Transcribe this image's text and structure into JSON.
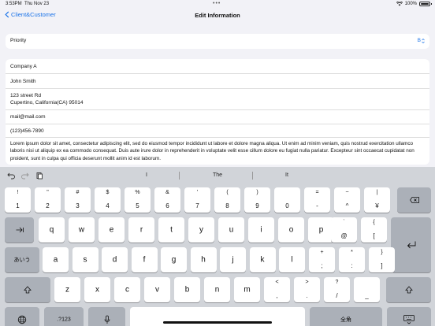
{
  "status_bar": {
    "time": "3:53PM",
    "date": "Thu Nov 23",
    "dots": "•••",
    "battery": "100%"
  },
  "nav": {
    "back_label": "Client&Customer",
    "title": "Edit Information"
  },
  "priority": {
    "label": "Priority",
    "value": "B"
  },
  "info": {
    "company": "Company A",
    "name": "John Smith",
    "address_line1": "123 street Rd",
    "address_line2": "Cupertino, California(CA) 95014",
    "email": "mail@mail.com",
    "phone": "(123)456-7890",
    "notes": "Lorem ipsum dolor sit amet, consectetur adipiscing elit, sed do eiusmod tempor incididunt ut labore et dolore magna aliqua. Ut enim ad minim veniam, quis nostrud exercitation ullamco laboris nisi ut aliquip ex ea commodo consequat. Duis aute irure dolor in reprehenderit in voluptate velit esse cillum dolore eu fugiat nulla pariatur. Excepteur sint occaecat cupidatat non proident, sunt in culpa qui officia deserunt mollit anim id est laborum."
  },
  "keyboard": {
    "suggestions": [
      "I",
      "The",
      "It"
    ],
    "row1": [
      {
        "top": "!",
        "bot": "1"
      },
      {
        "top": "\"",
        "bot": "2"
      },
      {
        "top": "#",
        "bot": "3"
      },
      {
        "top": "$",
        "bot": "4"
      },
      {
        "top": "%",
        "bot": "5"
      },
      {
        "top": "&",
        "bot": "6"
      },
      {
        "top": "'",
        "bot": "7"
      },
      {
        "top": "(",
        "bot": "8"
      },
      {
        "top": ")",
        "bot": "9"
      },
      {
        "top": "",
        "bot": "0"
      },
      {
        "top": "=",
        "bot": "-"
      },
      {
        "top": "~",
        "bot": "^"
      },
      {
        "top": "|",
        "bot": "¥"
      }
    ],
    "row2": [
      "q",
      "w",
      "e",
      "r",
      "t",
      "y",
      "u",
      "i",
      "o",
      "p"
    ],
    "row2_extra": [
      {
        "top": "`",
        "bot": "@"
      },
      {
        "top": "{",
        "bot": "["
      }
    ],
    "row3": [
      "a",
      "s",
      "d",
      "f",
      "g",
      "h",
      "j",
      "k",
      "l"
    ],
    "row3_extra": [
      {
        "top": "+",
        "bot": ";"
      },
      {
        "top": "*",
        "bot": ":"
      },
      {
        "top": "}",
        "bot": "]"
      }
    ],
    "row4": [
      "z",
      "x",
      "c",
      "v",
      "b",
      "n",
      "m"
    ],
    "row4_extra": [
      {
        "top": "<",
        "bot": ","
      },
      {
        "top": ">",
        "bot": "."
      },
      {
        "top": "?",
        "bot": "/"
      },
      {
        "top": "",
        "bot": "_"
      }
    ],
    "lang_label": "あいう",
    "numbers_label": ".?123",
    "zenkaku_label": "全角"
  }
}
